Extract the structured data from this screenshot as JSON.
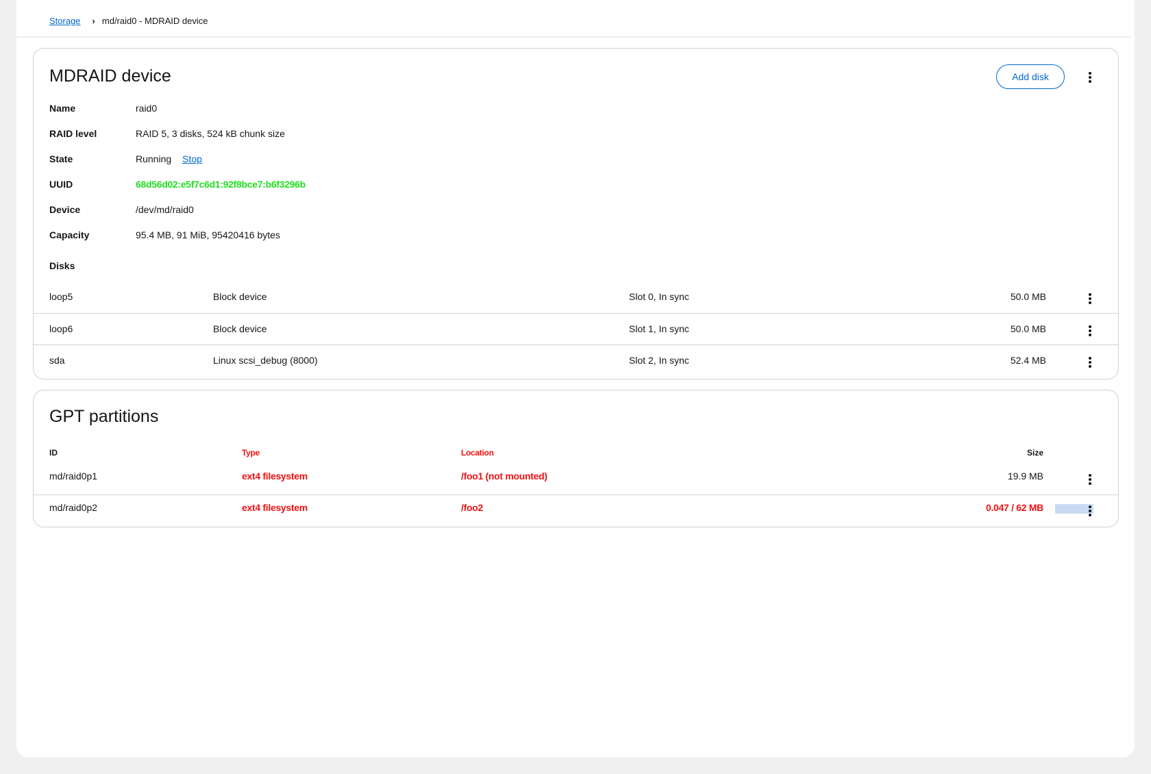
{
  "breadcrumb": {
    "root_label": "Storage",
    "current_label": "md/raid0 - MDRAID device"
  },
  "mdraid_card": {
    "title": "MDRAID device",
    "add_disk_label": "Add disk",
    "fields": {
      "name": {
        "label": "Name",
        "value": "raid0"
      },
      "raid_level": {
        "label": "RAID level",
        "value": "RAID 5, 3 disks, 524 kB chunk size"
      },
      "state": {
        "label": "State",
        "value": "Running",
        "action": "Stop"
      },
      "uuid": {
        "label": "UUID",
        "value": "68d56d02:e5f7c6d1:92f8bce7:b6f3296b"
      },
      "device": {
        "label": "Device",
        "value": "/dev/md/raid0"
      },
      "capacity": {
        "label": "Capacity",
        "value": "95.4 MB, 91 MiB, 95420416 bytes"
      }
    },
    "disks_label": "Disks",
    "disks": [
      {
        "name": "loop5",
        "type": "Block device",
        "slot": "Slot 0, In sync",
        "size": "50.0 MB"
      },
      {
        "name": "loop6",
        "type": "Block device",
        "slot": "Slot 1, In sync",
        "size": "50.0 MB"
      },
      {
        "name": "sda",
        "type": "Linux scsi_debug (8000)",
        "slot": "Slot 2, In sync",
        "size": "52.4 MB"
      }
    ]
  },
  "gpt_card": {
    "title": "GPT partitions",
    "columns": {
      "id": "ID",
      "type": "Type",
      "location": "Location",
      "size": "Size"
    },
    "partitions": [
      {
        "id": "md/raid0p1",
        "type": "ext4 filesystem",
        "location": "/foo1 (not mounted)",
        "size": "19.9 MB"
      },
      {
        "id": "md/raid0p2",
        "type": "ext4 filesystem",
        "location": "/foo2",
        "size": "0.047 / 62 MB",
        "usage_fraction": 0.001
      }
    ]
  },
  "colors": {
    "accent": "#0066cc",
    "masked_red": "#ee1111",
    "masked_green": "#22dd22",
    "usage_bar": "#c8dbf3"
  }
}
